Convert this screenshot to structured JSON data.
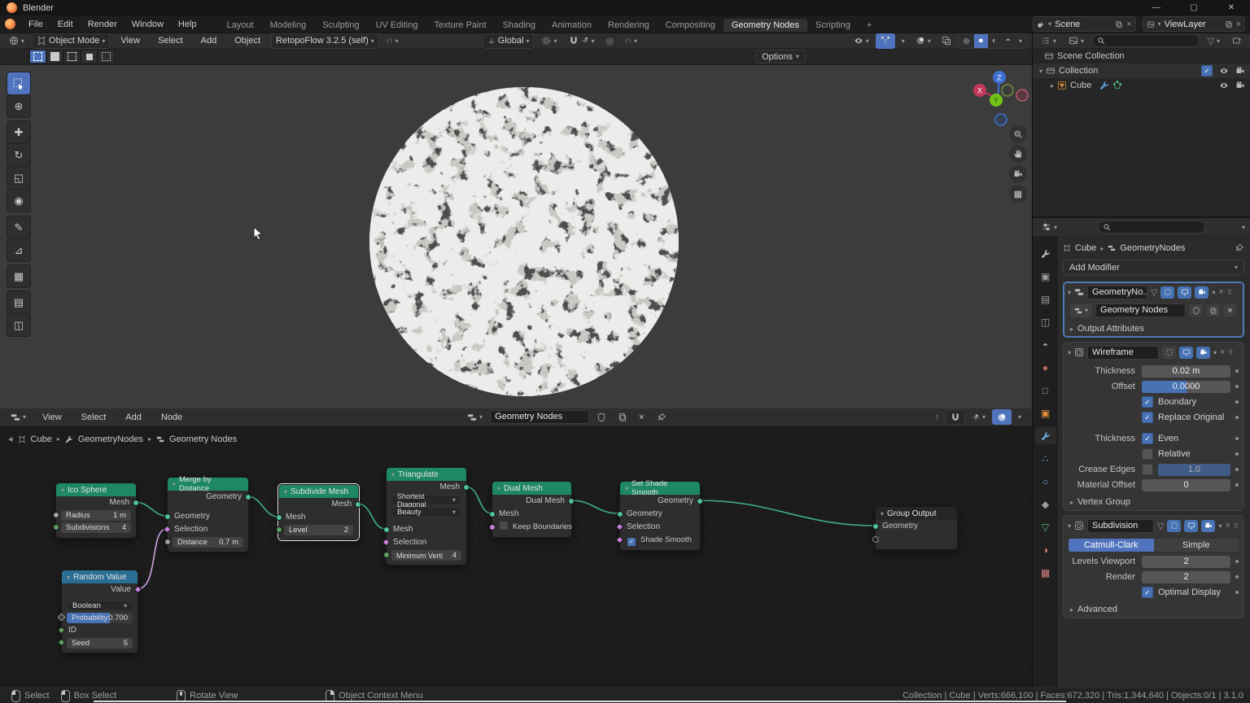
{
  "window": {
    "title": "Blender"
  },
  "icons": {
    "chevron_down": "▾",
    "chevron_right": "▸",
    "close": "×",
    "plus": "+",
    "grip": "⠿",
    "funnel": "▽",
    "check": "✓",
    "up_arrow": "↑",
    "back": "◂"
  },
  "topbar": {
    "menus": [
      "File",
      "Edit",
      "Render",
      "Window",
      "Help"
    ],
    "workspaces": [
      "Layout",
      "Modeling",
      "Sculpting",
      "UV Editing",
      "Texture Paint",
      "Shading",
      "Animation",
      "Rendering",
      "Compositing",
      "Geometry Nodes",
      "Scripting"
    ],
    "active_workspace": "Geometry Nodes",
    "scene_name": "Scene",
    "view_layer_name": "ViewLayer"
  },
  "viewport": {
    "mode": "Object Mode",
    "menus": [
      "View",
      "Select",
      "Add",
      "Object"
    ],
    "addon_dropdown": "RetopoFlow 3.2.5 (self)",
    "orientation": "Global",
    "options_label": "Options",
    "gizmo_axes": {
      "x": "X",
      "y": "Y",
      "z": "Z"
    }
  },
  "outliner": {
    "rows": [
      {
        "label": "Scene Collection"
      },
      {
        "label": "Collection"
      },
      {
        "label": "Cube"
      }
    ]
  },
  "properties": {
    "breadcrumb_object": "Cube",
    "breadcrumb_modifier": "GeometryNodes",
    "add_modifier_label": "Add Modifier",
    "gn_modifier": {
      "name": "GeometryNo...",
      "group": "Geometry Nodes",
      "output_attributes": "Output Attributes"
    },
    "wireframe": {
      "name": "Wireframe",
      "thickness_label": "Thickness",
      "thickness": "0.02 m",
      "offset_label": "Offset",
      "offset": "0.0000",
      "boundary": "Boundary",
      "replace_original": "Replace Original",
      "thickness_group_label": "Thickness",
      "even": "Even",
      "relative": "Relative",
      "crease_label": "Crease Edges",
      "crease": "1.0",
      "material_offset_label": "Material Offset",
      "material_offset": "0",
      "vertex_group": "Vertex Group"
    },
    "subdivision": {
      "name": "Subdivision",
      "catmull": "Catmull-Clark",
      "simple": "Simple",
      "levels_label": "Levels Viewport",
      "levels": "2",
      "render_label": "Render",
      "render": "2",
      "optimal": "Optimal Display",
      "advanced": "Advanced"
    }
  },
  "node_editor": {
    "menus": [
      "View",
      "Select",
      "Add",
      "Node"
    ],
    "tree_name": "Geometry Nodes",
    "breadcrumb": [
      "Cube",
      "GeometryNodes",
      "Geometry Nodes"
    ],
    "nodes": {
      "ico_sphere": {
        "title": "Ico Sphere",
        "output": "Mesh",
        "radius_label": "Radius",
        "radius_value": "1 m",
        "subdiv_label": "Subdivisions",
        "subdiv_value": "4"
      },
      "random_value": {
        "title": "Random Value",
        "output": "Value",
        "dropdown": "Boolean",
        "prob_label": "Probability",
        "prob_value": "0.700",
        "id_label": "ID",
        "seed_label": "Seed",
        "seed_value": "5"
      },
      "merge": {
        "title": "Merge by Distance",
        "output": "Geometry",
        "input": "Geometry",
        "selection": "Selection",
        "distance_label": "Distance",
        "distance_value": "0.7 m"
      },
      "subdivide": {
        "title": "Subdivide Mesh",
        "output": "Mesh",
        "input": "Mesh",
        "level_label": "Level",
        "level_value": "2"
      },
      "triangulate": {
        "title": "Triangulate",
        "output": "Mesh",
        "dropdown1": "Shortest Diagonal",
        "dropdown2": "Beauty",
        "input": "Mesh",
        "selection": "Selection",
        "minverts_label": "Minimum Verti",
        "minverts_value": "4"
      },
      "dual_mesh": {
        "title": "Dual Mesh",
        "output": "Dual Mesh",
        "input": "Mesh",
        "keep_boundaries": "Keep Boundaries"
      },
      "shade_smooth": {
        "title": "Set Shade Smooth",
        "output": "Geometry",
        "input": "Geometry",
        "selection": "Selection",
        "smooth": "Shade Smooth"
      },
      "group_output": {
        "title": "Group Output",
        "input": "Geometry"
      }
    }
  },
  "status": {
    "items": [
      "Select",
      "Box Select",
      "Rotate View",
      "Object Context Menu"
    ],
    "stats": "Collection | Cube | Verts:666,100 | Faces:672,320 | Tris:1,344,640 | Objects:0/1 | 3.1.0"
  },
  "colors": {
    "accent_blue": "#4772b3",
    "node_green": "#1e8765",
    "node_blue": "#2b6e94",
    "wire_teal": "#3fae8c",
    "wire_pink": "#cfa3e0"
  }
}
